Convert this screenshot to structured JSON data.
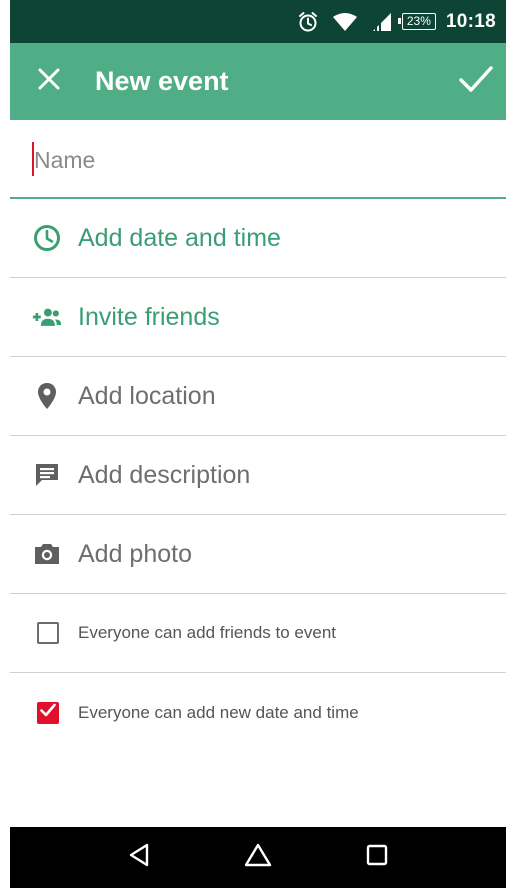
{
  "status_bar": {
    "battery_percent": "23%",
    "time": "10:18",
    "icons": [
      "alarm-icon",
      "wifi-icon",
      "signal-icon",
      "battery-icon"
    ]
  },
  "toolbar": {
    "title": "New event",
    "close_icon": "close-icon",
    "confirm_icon": "check-icon"
  },
  "form": {
    "name_placeholder": "Name",
    "name_value": "",
    "rows": [
      {
        "label": "Add date and time",
        "icon": "clock-icon"
      },
      {
        "label": "Invite friends",
        "icon": "add-group-icon"
      },
      {
        "label": "Add location",
        "icon": "location-pin-icon"
      },
      {
        "label": "Add description",
        "icon": "comment-icon"
      },
      {
        "label": "Add photo",
        "icon": "camera-icon"
      }
    ],
    "checkboxes": [
      {
        "label": "Everyone can add friends to event",
        "checked": false
      },
      {
        "label": "Everyone can add new date and time",
        "checked": true
      }
    ]
  },
  "nav_bar": {
    "icons": [
      "back-icon",
      "home-icon",
      "recents-icon"
    ]
  },
  "colors": {
    "status_bar": "#0d4434",
    "toolbar": "#4fae86",
    "accent_green": "#3a9e74",
    "checkbox_red": "#e0112d",
    "nav_bar": "#000000"
  }
}
